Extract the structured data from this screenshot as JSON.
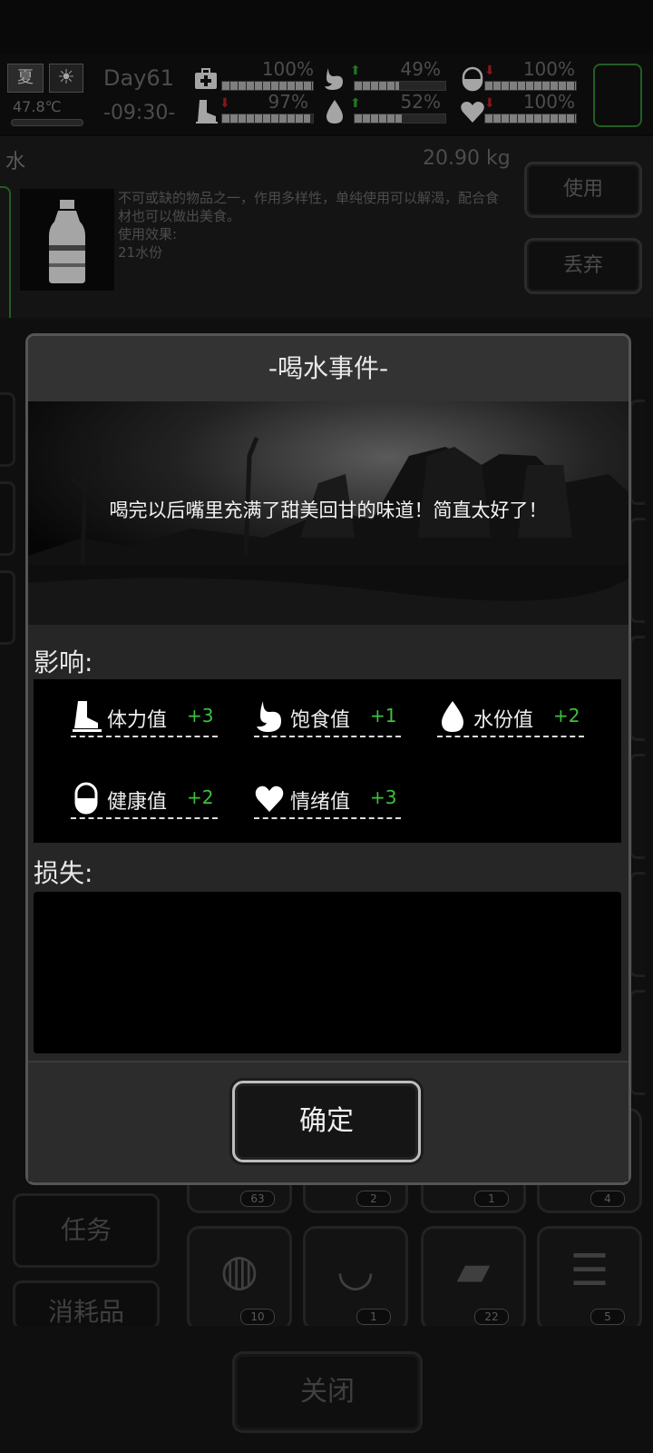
{
  "status_bar": {
    "season": "夏",
    "weather_icon": "sun-icon",
    "temperature": "47.8℃",
    "day": "Day61",
    "time": "-09:30-",
    "stats": [
      {
        "icon": "medkit-icon",
        "value": "100%",
        "trend": "none",
        "level": 1.0
      },
      {
        "icon": "stomach-icon",
        "value": "49%",
        "trend": "up",
        "level": 0.49
      },
      {
        "icon": "pill-icon",
        "value": "100%",
        "trend": "down",
        "level": 1.0
      },
      {
        "icon": "boot-icon",
        "value": "97%",
        "trend": "down",
        "level": 0.97
      },
      {
        "icon": "water-drop-icon",
        "value": "52%",
        "trend": "up",
        "level": 0.52
      },
      {
        "icon": "heart-icon",
        "value": "100%",
        "trend": "down",
        "level": 1.0
      }
    ]
  },
  "item": {
    "name": "水",
    "weight": "20.90 kg",
    "icon": "water-bottle-icon",
    "description": "不可或缺的物品之一，作用多样性，单纯使用可以解渴，配合食材也可以做出美食。",
    "effect_label": "使用效果:",
    "effect_value": "21水份",
    "use_label": "使用",
    "discard_label": "丢弃"
  },
  "inventory": {
    "categories": [
      "任务",
      "消耗品"
    ],
    "partial_row_counts": [
      "63",
      "2",
      "1",
      "4"
    ],
    "slots": [
      {
        "icon": "cooking-pot-icon",
        "count": "10"
      },
      {
        "icon": "soup-bowl-icon",
        "count": "1"
      },
      {
        "icon": "bread-icon",
        "count": "22"
      },
      {
        "icon": "burger-icon",
        "count": "5"
      }
    ]
  },
  "close_label": "关闭",
  "dialog": {
    "title": "-喝水事件-",
    "message": "喝完以后嘴里充满了甜美回甘的味道！简直太好了！",
    "effects_label": "影响:",
    "effects": [
      {
        "icon": "boot-icon",
        "name": "体力值",
        "value": "+3"
      },
      {
        "icon": "stomach-icon",
        "name": "饱食值",
        "value": "+1"
      },
      {
        "icon": "water-drop-icon",
        "name": "水份值",
        "value": "+2"
      },
      {
        "icon": "pill-icon",
        "name": "健康值",
        "value": "+2"
      },
      {
        "icon": "heart-icon",
        "name": "情绪值",
        "value": "+3"
      }
    ],
    "loss_label": "损失:",
    "confirm_label": "确定",
    "colors": {
      "positive": "#3cc23c",
      "negative": "#b21f1f",
      "accent_border": "#2f7d2f"
    }
  }
}
